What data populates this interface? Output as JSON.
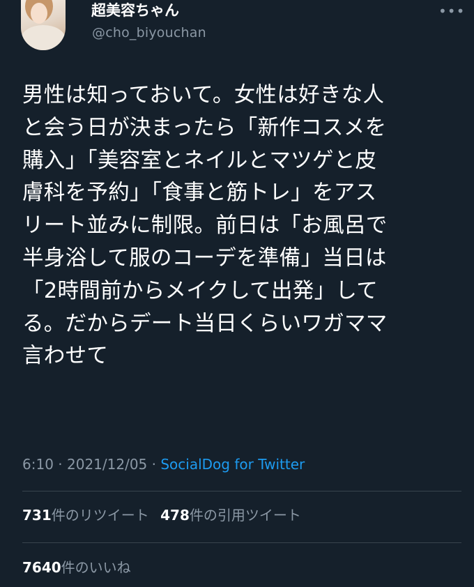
{
  "user": {
    "display_name": "超美容ちゃん",
    "handle": "@cho_biyouchan"
  },
  "more_icon": "•••",
  "tweet": {
    "text": "男性は知っておいて。女性は好きな人\nと会う日が決まったら「新作コスメを\n購入」「美容室とネイルとマツゲと皮\n膚科を予約」「食事と筋トレ」をアス\nリート並みに制限。前日は「お風呂で\n半身浴して服のコーデを準備」当日は\n「2時間前からメイクして出発」して\nる。だからデート当日くらいワガママ\n言わせて"
  },
  "meta": {
    "time": "6:10",
    "separator": "·",
    "date": "2021/12/05",
    "source": "SocialDog for Twitter"
  },
  "stats": {
    "retweets_count": "731",
    "retweets_label": "件のリツイート",
    "quotes_count": "478",
    "quotes_label": "件の引用ツイート",
    "likes_count": "7640",
    "likes_label": "件のいいね"
  },
  "colors": {
    "background": "#15202b",
    "text": "#ffffff",
    "secondary": "#8b98a5",
    "link": "#1d9bf0",
    "divider": "#38444d"
  }
}
